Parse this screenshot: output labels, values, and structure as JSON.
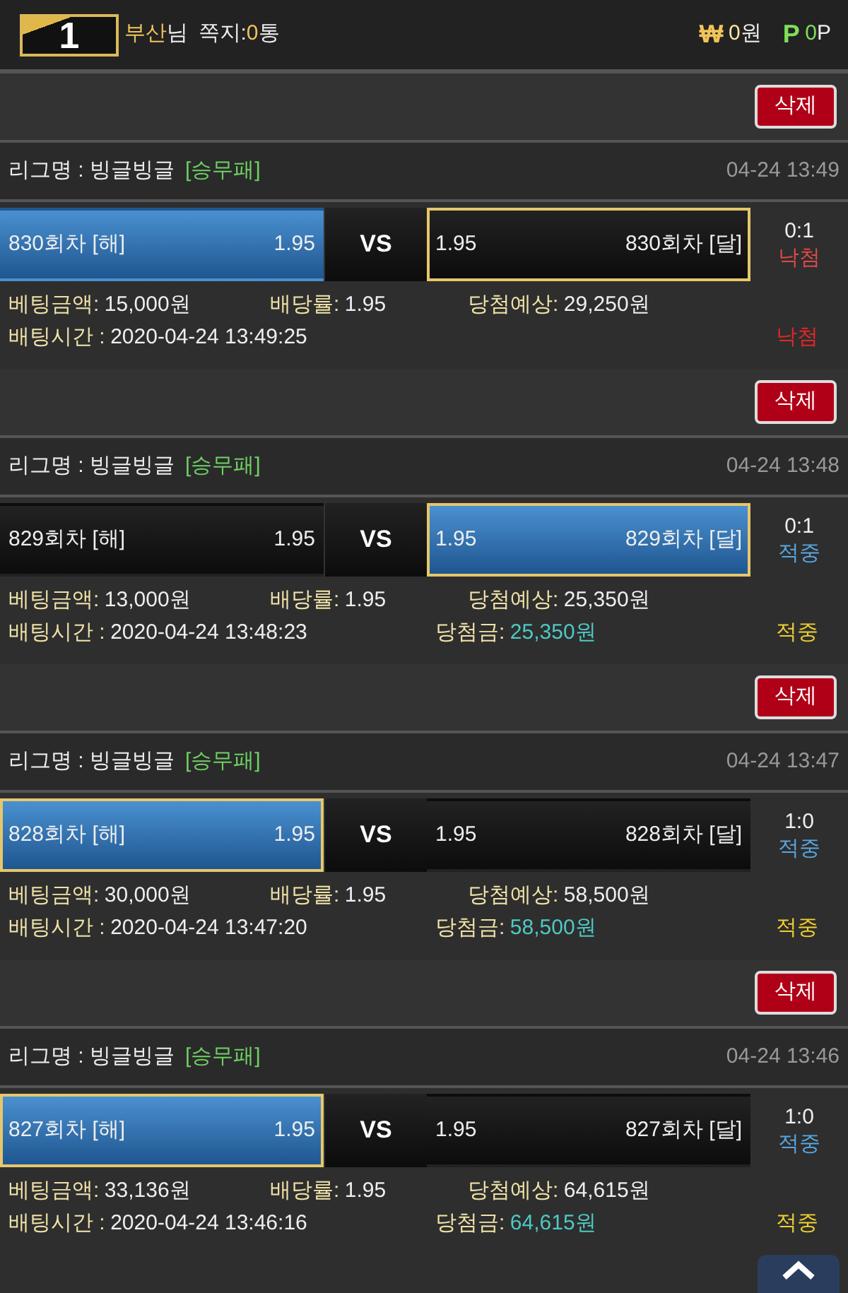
{
  "header": {
    "rank": "1",
    "user": {
      "name": "부산",
      "suffix": "님"
    },
    "messages": {
      "label": "쪽지:",
      "count": "0",
      "unit": "통"
    },
    "cash": {
      "symbol": "₩",
      "amount": "0",
      "unit": "원"
    },
    "points": {
      "symbol": "P",
      "amount": "0",
      "unit": "P"
    }
  },
  "bets": [
    {
      "delete_label": "삭제",
      "league_label": "리그명 : 빙글빙글",
      "market": "[승무패]",
      "date": "04-24 13:49",
      "home": {
        "name": "830회차 [해]",
        "odds": "1.95",
        "picked": true,
        "winner": false
      },
      "vs": "VS",
      "away": {
        "name": "830회차 [달]",
        "odds": "1.95",
        "picked": false,
        "winner": true
      },
      "score": "0:1",
      "result": "낙첨",
      "kind": "lose",
      "amount_label": "베팅금액:",
      "amount": "15,000원",
      "rate_label": "배당률:",
      "rate": "1.95",
      "expected_label": "당첨예상:",
      "expected": "29,250원",
      "time_label": "배팅시간 :",
      "time": "2020-04-24 13:49:25",
      "final": "낙첨"
    },
    {
      "delete_label": "삭제",
      "league_label": "리그명 : 빙글빙글",
      "market": "[승무패]",
      "date": "04-24 13:48",
      "home": {
        "name": "829회차 [해]",
        "odds": "1.95",
        "picked": false,
        "winner": false
      },
      "vs": "VS",
      "away": {
        "name": "829회차 [달]",
        "odds": "1.95",
        "picked": true,
        "winner": true
      },
      "score": "0:1",
      "result": "적중",
      "kind": "win",
      "amount_label": "베팅금액:",
      "amount": "13,000원",
      "rate_label": "배당률:",
      "rate": "1.95",
      "expected_label": "당첨예상:",
      "expected": "25,350원",
      "time_label": "배팅시간 :",
      "time": "2020-04-24 13:48:23",
      "payout_label": "당첨금:",
      "payout": "25,350원",
      "final": "적중"
    },
    {
      "delete_label": "삭제",
      "league_label": "리그명 : 빙글빙글",
      "market": "[승무패]",
      "date": "04-24 13:47",
      "home": {
        "name": "828회차 [해]",
        "odds": "1.95",
        "picked": true,
        "winner": true
      },
      "vs": "VS",
      "away": {
        "name": "828회차 [달]",
        "odds": "1.95",
        "picked": false,
        "winner": false
      },
      "score": "1:0",
      "result": "적중",
      "kind": "win",
      "amount_label": "베팅금액:",
      "amount": "30,000원",
      "rate_label": "배당률:",
      "rate": "1.95",
      "expected_label": "당첨예상:",
      "expected": "58,500원",
      "time_label": "배팅시간 :",
      "time": "2020-04-24 13:47:20",
      "payout_label": "당첨금:",
      "payout": "58,500원",
      "final": "적중"
    },
    {
      "delete_label": "삭제",
      "league_label": "리그명 : 빙글빙글",
      "market": "[승무패]",
      "date": "04-24 13:46",
      "home": {
        "name": "827회차 [해]",
        "odds": "1.95",
        "picked": true,
        "winner": true
      },
      "vs": "VS",
      "away": {
        "name": "827회차 [달]",
        "odds": "1.95",
        "picked": false,
        "winner": false
      },
      "score": "1:0",
      "result": "적중",
      "kind": "win",
      "amount_label": "베팅금액:",
      "amount": "33,136원",
      "rate_label": "배당률:",
      "rate": "1.95",
      "expected_label": "당첨예상:",
      "expected": "64,615원",
      "time_label": "배팅시간 :",
      "time": "2020-04-24 13:46:16",
      "payout_label": "당첨금:",
      "payout": "64,615원",
      "final": "적중"
    }
  ]
}
